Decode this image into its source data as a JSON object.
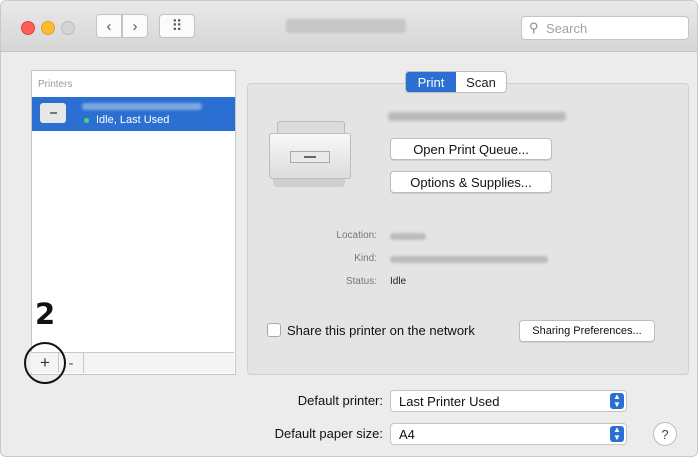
{
  "window": {
    "search": {
      "icon": "search-icon",
      "placeholder": "Search"
    },
    "nav": {
      "back_glyph": "‹",
      "forward_glyph": "›",
      "grid_glyph": "⠿"
    }
  },
  "sidebar": {
    "header": "Printers",
    "printers": [
      {
        "status": "Idle, Last Used",
        "selected": true,
        "status_color": "#4dd36c"
      }
    ],
    "add_symbol": "+",
    "remove_symbol": "-"
  },
  "annotation": {
    "step_number": "2"
  },
  "detail": {
    "tabs": [
      {
        "label": "Print",
        "selected": true
      },
      {
        "label": "Scan",
        "selected": false
      }
    ],
    "open_queue_label": "Open Print Queue...",
    "options_supplies_label": "Options & Supplies...",
    "location_label": "Location:",
    "kind_label": "Kind:",
    "status_label": "Status:",
    "status_value": "Idle",
    "share_label": "Share this printer on the network",
    "share_checked": false,
    "sharing_prefs_label": "Sharing Preferences..."
  },
  "defaults": {
    "printer_label": "Default printer:",
    "printer_value": "Last Printer Used",
    "paper_label": "Default paper size:",
    "paper_value": "A4"
  },
  "help_label": "?",
  "colors": {
    "accent": "#2a6fd1",
    "window_bg": "#ececec"
  }
}
